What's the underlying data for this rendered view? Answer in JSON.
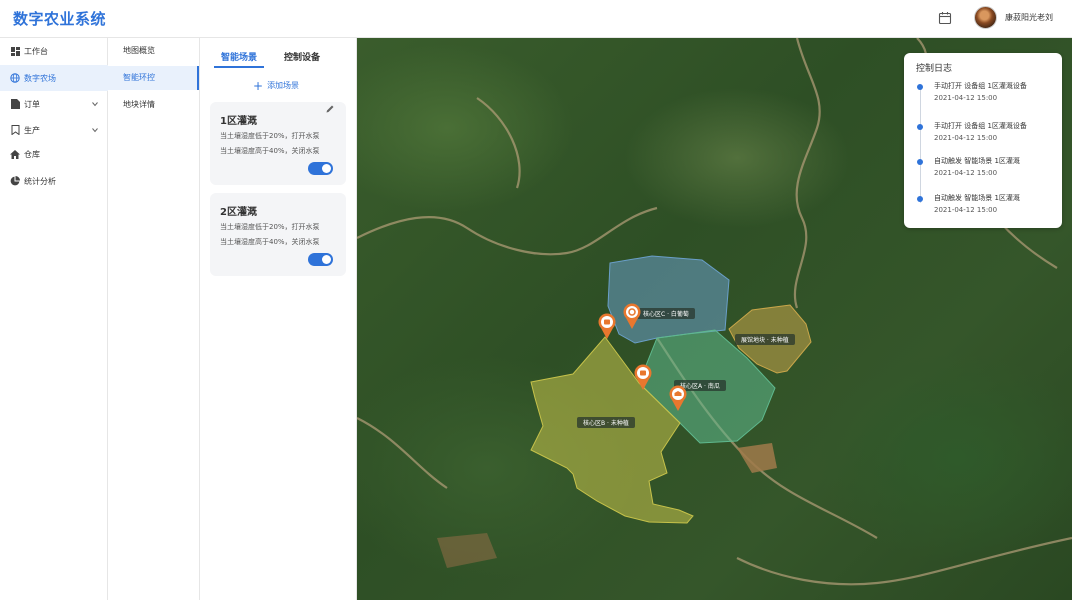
{
  "header": {
    "title": "数字农业系统",
    "username": "康菽阳光老刘"
  },
  "sidebar": {
    "items": [
      {
        "label": "工作台",
        "icon": "dashboard-icon"
      },
      {
        "label": "数字农场",
        "icon": "globe-icon",
        "active": true
      },
      {
        "label": "订单",
        "icon": "document-icon",
        "expandable": true
      },
      {
        "label": "生产",
        "icon": "bookmark-icon",
        "expandable": true
      },
      {
        "label": "仓库",
        "icon": "home-icon"
      },
      {
        "label": "统计分析",
        "icon": "pie-chart-icon"
      }
    ]
  },
  "submenu": {
    "items": [
      {
        "label": "地图概览"
      },
      {
        "label": "智能环控",
        "active": true
      },
      {
        "label": "地块详情"
      }
    ]
  },
  "panel": {
    "tabs": [
      {
        "label": "智能场景",
        "active": true
      },
      {
        "label": "控制设备"
      }
    ],
    "add_label": "添加场景",
    "cards": [
      {
        "title": "1区灌溉",
        "rules": [
          "当土壤湿度低于20%，打开水泵",
          "当土壤湿度高于40%，关闭水泵"
        ],
        "enabled": true
      },
      {
        "title": "2区灌溉",
        "rules": [
          "当土壤湿度低于20%，打开水泵",
          "当土壤湿度高于40%，关闭水泵"
        ],
        "enabled": true
      }
    ]
  },
  "map": {
    "zones": [
      {
        "label": "核心区C · 白葡萄",
        "color": "#6a9fc9"
      },
      {
        "label": "展馆地块 · 未种植",
        "color": "#c9a64a"
      },
      {
        "label": "核心区A · 南瓜",
        "color": "#5fb98e"
      },
      {
        "label": "核心区B · 未种植",
        "color": "#c6c24a"
      }
    ],
    "pin_color": "#e8772e"
  },
  "log": {
    "title": "控制日志",
    "entries": [
      {
        "text": "手动打开  设备组 1区灌溉设备",
        "time": "2021-04-12  15:00"
      },
      {
        "text": "手动打开  设备组 1区灌溉设备",
        "time": "2021-04-12  15:00"
      },
      {
        "text": "自动触发  智能场景 1区灌溉",
        "time": "2021-04-12  15:00"
      },
      {
        "text": "自动触发  智能场景 1区灌溉",
        "time": "2021-04-12  15:00"
      }
    ]
  }
}
